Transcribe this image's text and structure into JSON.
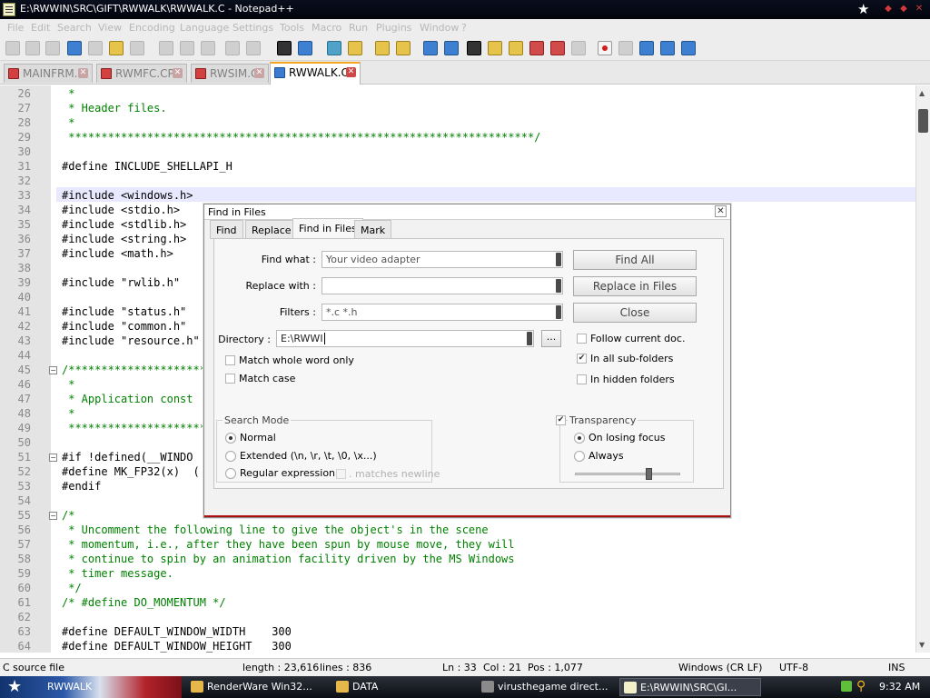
{
  "window": {
    "title": "E:\\RWWIN\\SRC\\GIFT\\RWWALK\\RWWALK.C - Notepad++"
  },
  "menu": [
    "File",
    "Edit",
    "Search",
    "View",
    "Encoding",
    "Language",
    "Settings",
    "Tools",
    "Macro",
    "Run",
    "Plugins",
    "Window",
    "?"
  ],
  "tabs": [
    {
      "label": "MAINFRM.H",
      "active": false
    },
    {
      "label": "RWMFC.CPP",
      "active": false
    },
    {
      "label": "RWSIM.C",
      "active": false
    },
    {
      "label": "RWWALK.C",
      "active": true
    }
  ],
  "editor": {
    "lines": [
      {
        "n": "26",
        "text": " *",
        "kind": "cm"
      },
      {
        "n": "27",
        "text": " * Header files.",
        "kind": "cm"
      },
      {
        "n": "28",
        "text": " *",
        "kind": "cm"
      },
      {
        "n": "29",
        "text": " ***********************************************************************/",
        "kind": "cm"
      },
      {
        "n": "30",
        "text": "",
        "kind": "code"
      },
      {
        "n": "31",
        "text": "#define INCLUDE_SHELLAPI_H",
        "kind": "code"
      },
      {
        "n": "32",
        "text": "",
        "kind": "code"
      },
      {
        "n": "33",
        "text": "#include <windows.h>",
        "kind": "code"
      },
      {
        "n": "34",
        "text": "#include <stdio.h>",
        "kind": "code"
      },
      {
        "n": "35",
        "text": "#include <stdlib.h>",
        "kind": "code"
      },
      {
        "n": "36",
        "text": "#include <string.h>",
        "kind": "code"
      },
      {
        "n": "37",
        "text": "#include <math.h>",
        "kind": "code"
      },
      {
        "n": "38",
        "text": "",
        "kind": "code"
      },
      {
        "n": "39",
        "text": "#include \"rwlib.h\"",
        "kind": "code"
      },
      {
        "n": "40",
        "text": "",
        "kind": "code"
      },
      {
        "n": "41",
        "text": "#include \"status.h\"",
        "kind": "code"
      },
      {
        "n": "42",
        "text": "#include \"common.h\"",
        "kind": "code"
      },
      {
        "n": "43",
        "text": "#include \"resource.h\"",
        "kind": "code"
      },
      {
        "n": "44",
        "text": "",
        "kind": "code"
      },
      {
        "n": "45",
        "text": "/***********************",
        "kind": "cm"
      },
      {
        "n": "46",
        "text": " *",
        "kind": "cm"
      },
      {
        "n": "47",
        "text": " * Application const",
        "kind": "cm"
      },
      {
        "n": "48",
        "text": " *",
        "kind": "cm"
      },
      {
        "n": "49",
        "text": " ***********************",
        "kind": "cm"
      },
      {
        "n": "50",
        "text": "",
        "kind": "code"
      },
      {
        "n": "51",
        "text": "#if !defined(__WINDO",
        "kind": "code"
      },
      {
        "n": "52",
        "text": "#define MK_FP32(x)  (",
        "kind": "code"
      },
      {
        "n": "53",
        "text": "#endif",
        "kind": "code"
      },
      {
        "n": "54",
        "text": "",
        "kind": "code"
      },
      {
        "n": "55",
        "text": "/*",
        "kind": "cm"
      },
      {
        "n": "56",
        "text": " * Uncomment the following line to give the object's in the scene",
        "kind": "cm"
      },
      {
        "n": "57",
        "text": " * momentum, i.e., after they have been spun by mouse move, they will",
        "kind": "cm"
      },
      {
        "n": "58",
        "text": " * continue to spin by an animation facility driven by the MS Windows",
        "kind": "cm"
      },
      {
        "n": "59",
        "text": " * timer message.",
        "kind": "cm"
      },
      {
        "n": "60",
        "text": " */",
        "kind": "cm"
      },
      {
        "n": "61",
        "text": "/* #define DO_MOMENTUM */",
        "kind": "cm"
      },
      {
        "n": "62",
        "text": "",
        "kind": "code"
      },
      {
        "n": "63",
        "text": "#define DEFAULT_WINDOW_WIDTH    300",
        "kind": "code"
      },
      {
        "n": "64",
        "text": "#define DEFAULT_WINDOW_HEIGHT   300",
        "kind": "code"
      }
    ]
  },
  "dialog": {
    "title": "Find in Files",
    "tabs": [
      "Find",
      "Replace",
      "Find in Files",
      "Mark"
    ],
    "find_what_label": "Find what :",
    "find_what_value": "Your video adapter",
    "replace_with_label": "Replace with :",
    "replace_with_value": "",
    "filters_label": "Filters :",
    "filters_value": "*.c *.h",
    "directory_label": "Directory :",
    "directory_value": "E:\\RWWI",
    "browse_label": "...",
    "find_all": "Find All",
    "replace_in_files": "Replace in Files",
    "close": "Close",
    "follow_current_doc": "Follow current doc.",
    "in_all_subfolders": "In all sub-folders",
    "in_hidden_folders": "In hidden folders",
    "match_whole_word": "Match whole word only",
    "match_case": "Match case",
    "search_mode_title": "Search Mode",
    "mode_normal": "Normal",
    "mode_extended": "Extended (\\n, \\r, \\t, \\0, \\x...)",
    "mode_regex": "Regular expression",
    "matches_newline": ". matches newline",
    "transparency": "Transparency",
    "on_losing_focus": "On losing focus",
    "always": "Always"
  },
  "statusbar": {
    "filetype": "C source file",
    "length": "length : 23,616",
    "lines": "lines : 836",
    "ln": "Ln : 33",
    "col": "Col : 21",
    "pos": "Pos : 1,077",
    "eol": "Windows (CR LF)",
    "encoding": "UTF-8",
    "mode": "INS"
  },
  "taskbar": {
    "start_label": "RWWALK",
    "tasks": [
      "RenderWare Win32...",
      "DATA",
      "virusthegame direct...",
      "E:\\RWWIN\\SRC\\GI..."
    ],
    "clock": "9:32 AM"
  }
}
